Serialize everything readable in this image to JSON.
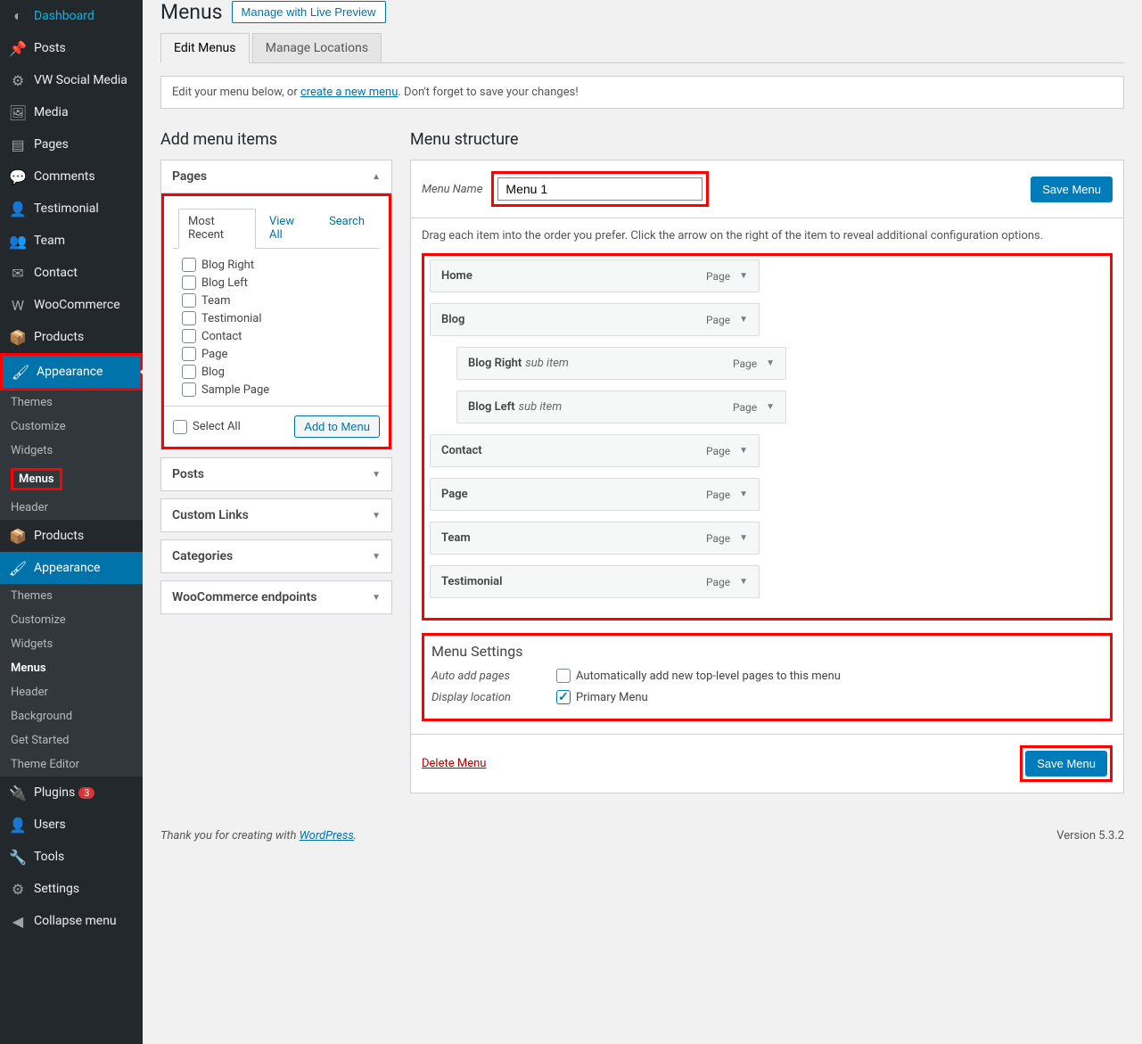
{
  "page": {
    "title": "Menus",
    "preview_btn": "Manage with Live Preview"
  },
  "tabs": {
    "edit": "Edit Menus",
    "locations": "Manage Locations"
  },
  "info": {
    "prefix": "Edit your menu below, or ",
    "link": "create a new menu",
    "suffix": ". Don't forget to save your changes!"
  },
  "sidebar": {
    "items": [
      {
        "label": "Dashboard",
        "icon": "◐"
      },
      {
        "label": "Posts",
        "icon": "📌"
      },
      {
        "label": "VW Social Media",
        "icon": "⚙"
      },
      {
        "label": "Media",
        "icon": "🖼"
      },
      {
        "label": "Pages",
        "icon": "▤"
      },
      {
        "label": "Comments",
        "icon": "💬"
      },
      {
        "label": "Testimonial",
        "icon": "👤"
      },
      {
        "label": "Team",
        "icon": "👥"
      },
      {
        "label": "Contact",
        "icon": "✉"
      },
      {
        "label": "WooCommerce",
        "icon": "W"
      },
      {
        "label": "Products",
        "icon": "📦"
      },
      {
        "label": "Appearance",
        "icon": "🖌"
      },
      {
        "label": "Products",
        "icon": "📦"
      },
      {
        "label": "Appearance",
        "icon": "🖌"
      },
      {
        "label": "Plugins",
        "icon": "🔌",
        "badge": "3"
      },
      {
        "label": "Users",
        "icon": "👤"
      },
      {
        "label": "Tools",
        "icon": "🔧"
      },
      {
        "label": "Settings",
        "icon": "⚙"
      },
      {
        "label": "Collapse menu",
        "icon": "◀"
      }
    ],
    "sub1": [
      "Themes",
      "Customize",
      "Widgets",
      "Menus",
      "Header"
    ],
    "sub2": [
      "Themes",
      "Customize",
      "Widgets",
      "Menus",
      "Header",
      "Background",
      "Get Started",
      "Theme Editor"
    ]
  },
  "left": {
    "heading": "Add menu items",
    "pages_label": "Pages",
    "subtabs": {
      "recent": "Most Recent",
      "all": "View All",
      "search": "Search"
    },
    "pages": [
      "Blog Right",
      "Blog Left",
      "Team",
      "Testimonial",
      "Contact",
      "Page",
      "Blog",
      "Sample Page"
    ],
    "select_all": "Select All",
    "add_btn": "Add to Menu",
    "posts": "Posts",
    "links": "Custom Links",
    "cats": "Categories",
    "woo": "WooCommerce endpoints"
  },
  "right": {
    "heading": "Menu structure",
    "name_label": "Menu Name",
    "name_value": "Menu 1",
    "save_btn": "Save Menu",
    "desc": "Drag each item into the order you prefer. Click the arrow on the right of the item to reveal additional configuration options.",
    "items": [
      {
        "title": "Home",
        "type": "Page",
        "sub": false
      },
      {
        "title": "Blog",
        "type": "Page",
        "sub": false
      },
      {
        "title": "Blog Right",
        "type": "Page",
        "sub": true,
        "subtext": "sub item"
      },
      {
        "title": "Blog Left",
        "type": "Page",
        "sub": true,
        "subtext": "sub item"
      },
      {
        "title": "Contact",
        "type": "Page",
        "sub": false
      },
      {
        "title": "Page",
        "type": "Page",
        "sub": false
      },
      {
        "title": "Team",
        "type": "Page",
        "sub": false
      },
      {
        "title": "Testimonial",
        "type": "Page",
        "sub": false
      }
    ],
    "settings": {
      "heading": "Menu Settings",
      "auto_label": "Auto add pages",
      "auto_check": "Automatically add new top-level pages to this menu",
      "loc_label": "Display location",
      "loc_check": "Primary Menu"
    },
    "delete": "Delete Menu"
  },
  "footer": {
    "prefix": "Thank you for creating with ",
    "link": "WordPress",
    "suffix": ".",
    "version": "Version 5.3.2"
  }
}
